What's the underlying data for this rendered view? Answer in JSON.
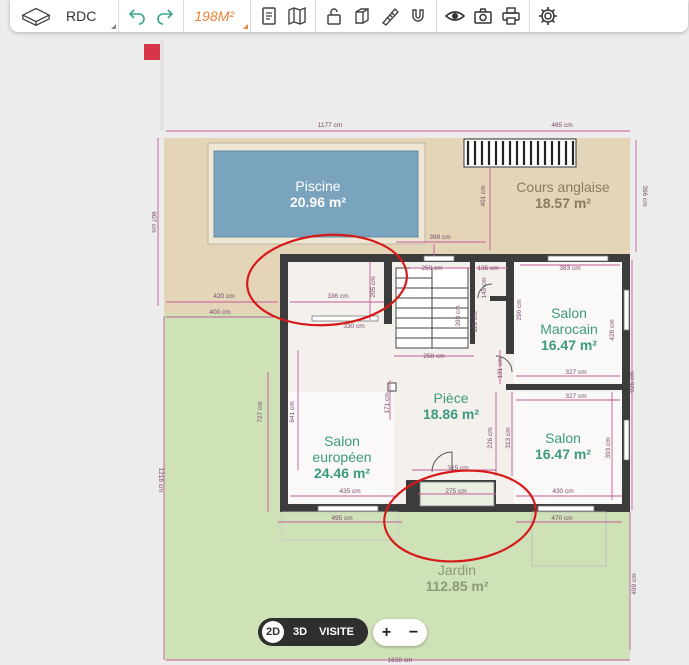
{
  "toolbar": {
    "floor_label": "RDC",
    "area_label": "198M²",
    "icons": [
      "home-3d-icon",
      "undo-icon",
      "redo-icon",
      "document-icon",
      "map-icon",
      "lock-icon",
      "cube-icon",
      "ruler-icon",
      "magnet-icon",
      "eye-icon",
      "camera-icon",
      "print-icon",
      "settings-icon"
    ]
  },
  "plan": {
    "rooms": [
      {
        "name": "Piscine",
        "area": "20.96 m²"
      },
      {
        "name": "Cours anglaise",
        "area": "18.57 m²"
      },
      {
        "name": "Salon Marocain",
        "line1": "Salon",
        "line2": "Marocain",
        "area": "16.47 m²"
      },
      {
        "name": "Pièce",
        "area": "18.86 m²"
      },
      {
        "name": "Salon européen",
        "line1": "Salon",
        "line2": "européen",
        "area": "24.46 m²"
      },
      {
        "name": "Salon",
        "area": "16.47 m²"
      },
      {
        "name": "Jardin",
        "area": "112.85 m²"
      }
    ],
    "dims": {
      "d1177": "1177 cm",
      "d465": "465 cm",
      "d399": "399 cm",
      "d401": "401 cm",
      "d396": "396 cm",
      "d607": "607 cm",
      "d420": "420 cm",
      "d400": "400 cm",
      "d336": "336 cm",
      "d205": "205 cm",
      "d250": "250 cm",
      "d135": "135 cm",
      "d145": "145 cm",
      "d383": "383 cm",
      "d296": "296 cm",
      "d428": "428 cm",
      "d258": "258 cm",
      "d131": "131 cm",
      "d129": "129 cm",
      "d327a": "327 cm",
      "d327b": "327 cm",
      "d926": "926 cm",
      "d727": "727 cm",
      "d641": "641 cm",
      "d171": "171 cm",
      "d226": "226 cm",
      "d313": "313 cm",
      "d393": "393 cm",
      "d315": "315 cm",
      "d435": "435 cm",
      "d275": "275 cm",
      "d430": "430 cm",
      "d495": "495 cm",
      "d470": "470 cm",
      "d1218": "1218 cm",
      "d499": "499 cm",
      "d1638": "1638 cm",
      "d393b": "393 cm",
      "d330": "330 cm"
    }
  },
  "view": {
    "btn_2d": "2D",
    "btn_3d": "3D",
    "btn_visite": "VISITE"
  },
  "zoom": {
    "plus": "+",
    "minus": "−"
  },
  "colors": {
    "terrace": "#e4d5b9",
    "garden": "#cfe1b7",
    "pool": "#7aa3bd",
    "wall": "#3c3c3c",
    "dimension": "#c45a9a",
    "accent": "#e8833a",
    "marker": "#d9344a",
    "annotation": "#d61a1a",
    "room_label": "#3d9a80"
  }
}
